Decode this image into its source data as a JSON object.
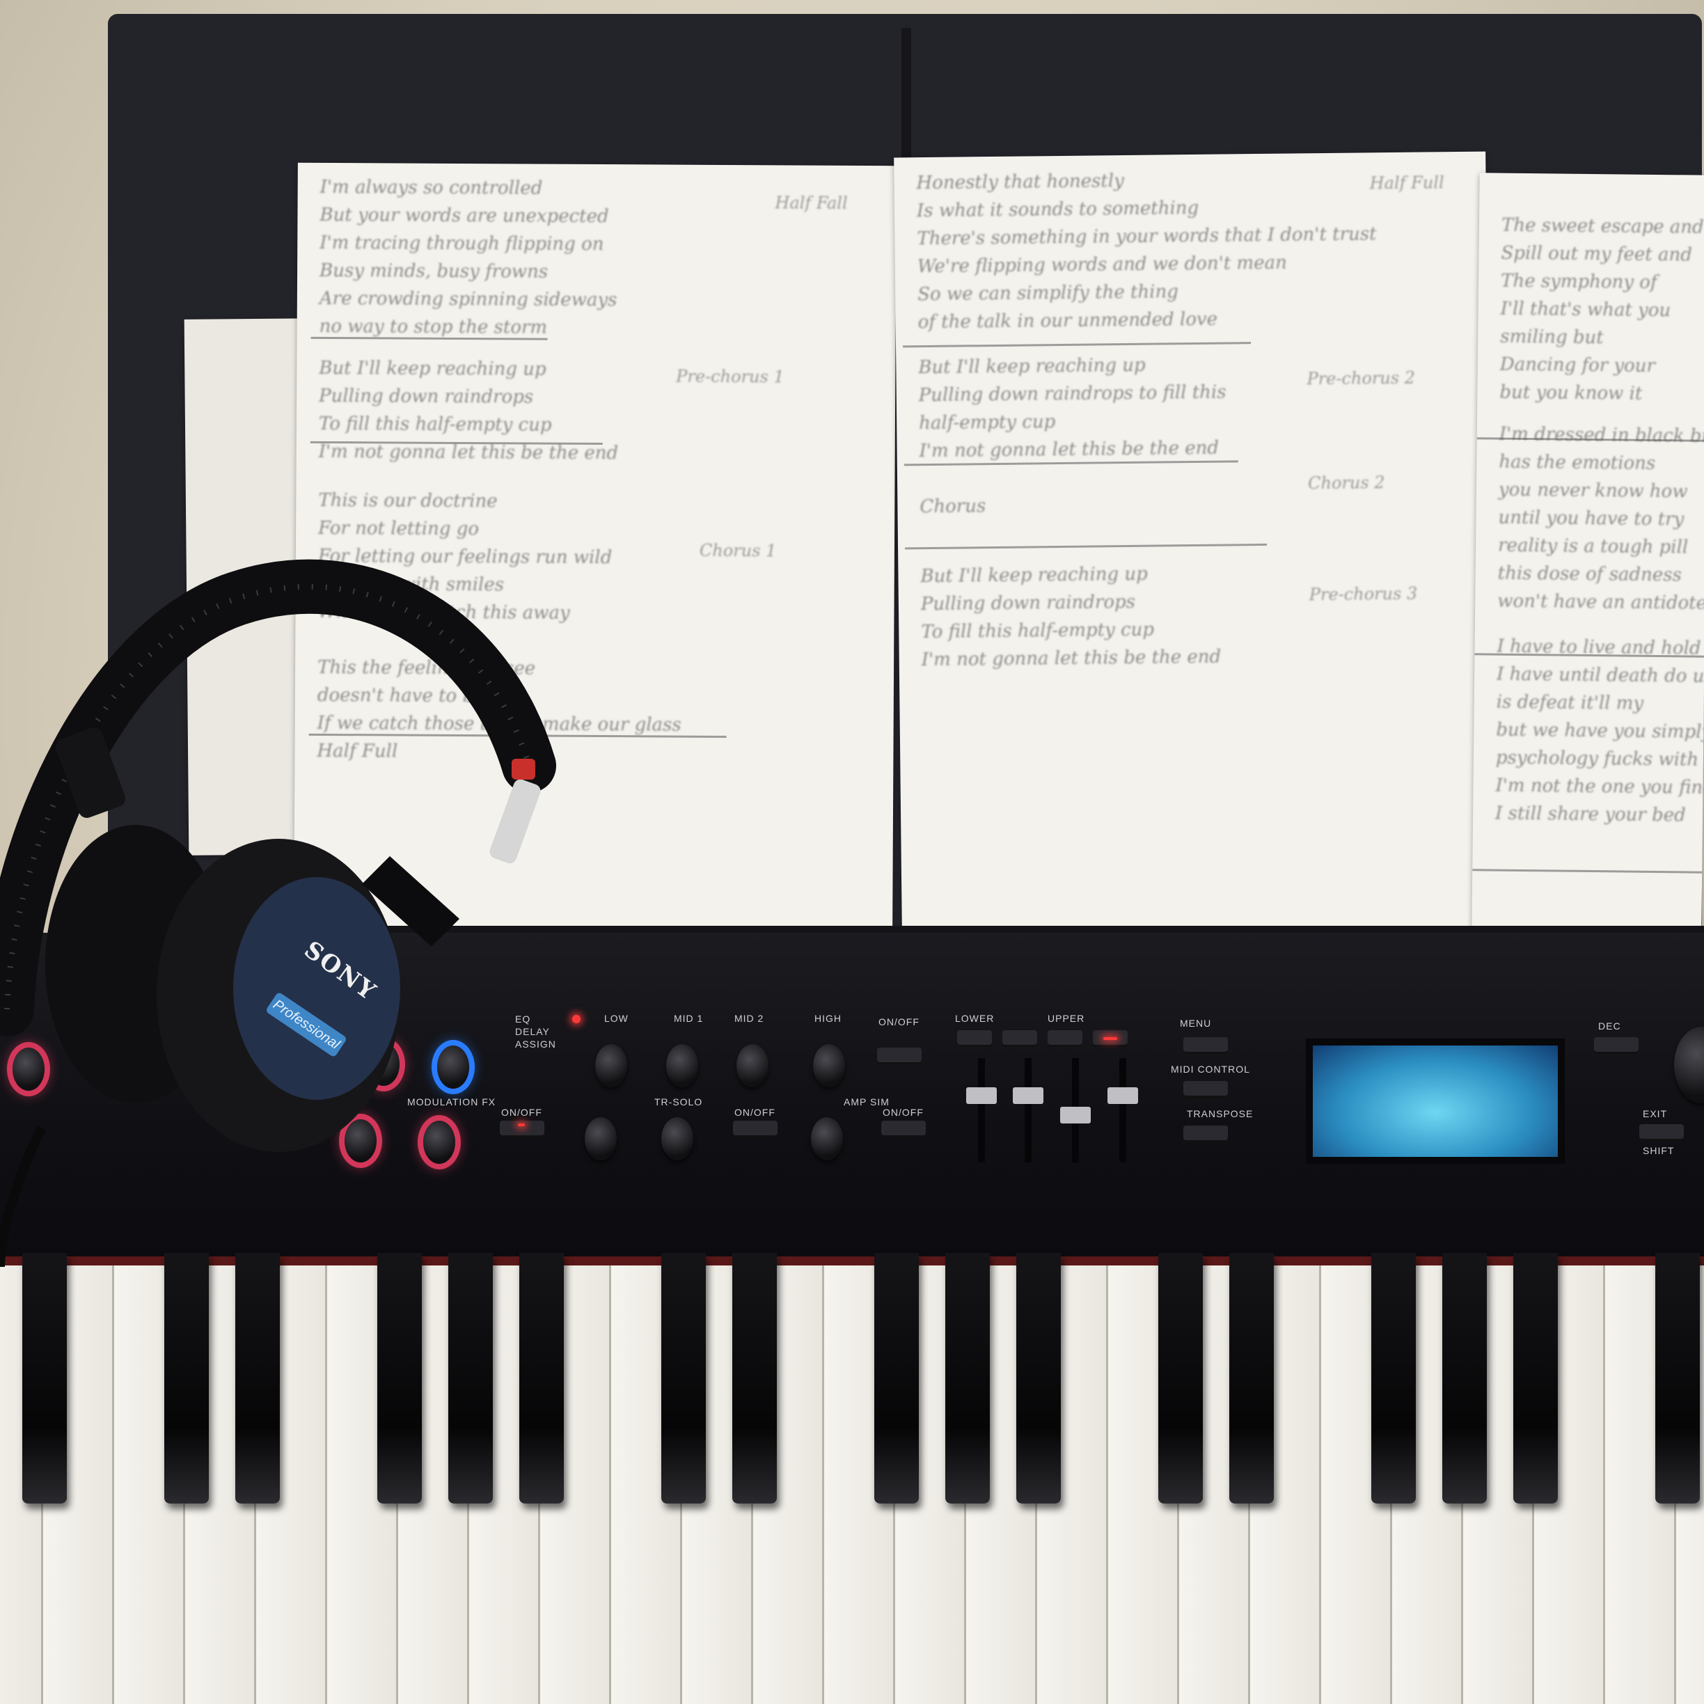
{
  "headphones": {
    "brand": "SONY",
    "label": "Professional"
  },
  "panel": {
    "labels": [
      {
        "key": "eq_delay_assign",
        "text": "EQ\nDELAY\nASSIGN"
      },
      {
        "key": "low",
        "text": "LOW"
      },
      {
        "key": "mid1",
        "text": "MID 1"
      },
      {
        "key": "mid2",
        "text": "MID 2"
      },
      {
        "key": "high",
        "text": "HIGH"
      },
      {
        "key": "onoff_top",
        "text": "ON/OFF"
      },
      {
        "key": "lower",
        "text": "LOWER"
      },
      {
        "key": "upper",
        "text": "UPPER"
      },
      {
        "key": "menu",
        "text": "MENU"
      },
      {
        "key": "midi_control",
        "text": "MIDI CONTROL"
      },
      {
        "key": "transpose",
        "text": "TRANSPOSE"
      },
      {
        "key": "modulation_fx",
        "text": "MODULATION FX"
      },
      {
        "key": "onoff_mod",
        "text": "ON/OFF"
      },
      {
        "key": "tr_solo",
        "text": "TR-SOLO"
      },
      {
        "key": "onoff_tr",
        "text": "ON/OFF"
      },
      {
        "key": "amp_sim",
        "text": "AMP SIM"
      },
      {
        "key": "onoff_amp",
        "text": "ON/OFF"
      },
      {
        "key": "dec",
        "text": "DEC"
      },
      {
        "key": "exit",
        "text": "EXIT"
      },
      {
        "key": "shift",
        "text": "SHIFT"
      }
    ]
  },
  "sheets": {
    "left": {
      "note_top": "Half Fall",
      "lines": [
        "I'm always so controlled",
        "But your words are unexpected",
        "I'm tracing through flipping on",
        "Busy minds, busy frowns",
        "Are crowding spinning sideways",
        "no way to stop the storm",
        "But I'll keep reaching up",
        "Pulling down raindrops",
        "To fill this half-empty cup",
        "I'm not gonna let this be the end",
        "This is our doctrine",
        "For not letting go",
        "For letting our feelings run wild",
        "Floating with smiles",
        "When they watch this away",
        "This the feeling you see",
        "doesn't have to be end",
        "If we catch those they'll make our glass",
        "Half Full"
      ],
      "side_notes": [
        "Pre-chorus 1",
        "Chorus 1"
      ]
    },
    "middle": {
      "note_top": "Half Full",
      "lines": [
        "Honestly that honestly",
        "Is what it sounds to something",
        "There's something in your words that I don't trust",
        "We're flipping words and we don't mean",
        "So we can simplify the thing",
        "of the talk in our unmended love",
        "But I'll keep reaching up",
        "Pulling down raindrops to fill this",
        "half-empty cup",
        "I'm not gonna let this be the end",
        "Chorus",
        "But I'll keep reaching up",
        "Pulling down raindrops",
        "To fill this half-empty cup",
        "I'm not gonna let this be the end"
      ],
      "side_notes": [
        "Pre-chorus 2",
        "Chorus 2",
        "Pre-chorus 3"
      ]
    },
    "right": {
      "lines": [
        "The sweet escape and dance",
        "Spill out my feet and",
        "The symphony of",
        "I'll that's what you",
        "smiling but",
        "Dancing for your",
        "but you know it",
        "I'm dressed in black but",
        "has the emotions",
        "you never know how",
        "until you have to try",
        "reality is a tough pill",
        "this dose of sadness",
        "won't have an antidote",
        "I have to live and hold",
        "I have until death do us",
        "is defeat it'll my",
        "but we have you simply",
        "psychology fucks with your",
        "I'm not the one you find",
        "I still share your bed"
      ]
    }
  }
}
